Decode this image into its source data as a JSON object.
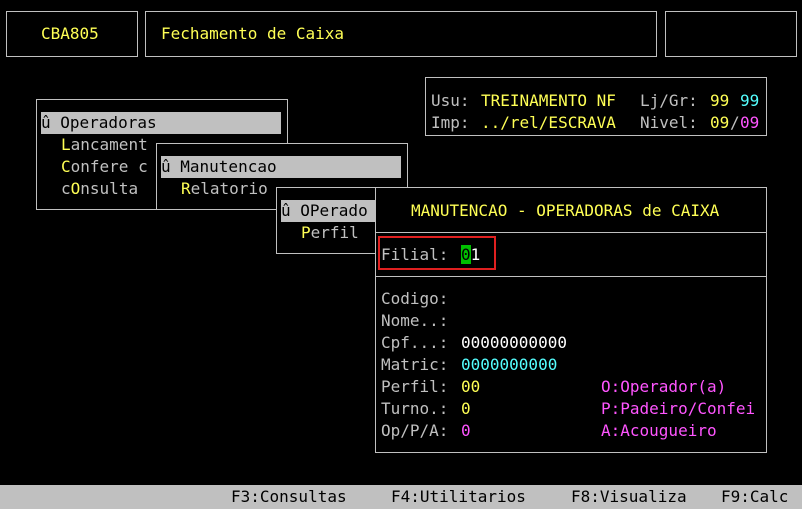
{
  "header": {
    "program_code": "CBA805",
    "screen_title": "Fechamento de Caixa"
  },
  "info": {
    "usu_label": "Usu:",
    "usu_value": "TREINAMENTO NF",
    "ljgr_label": "Lj/Gr:",
    "lj_value": "99",
    "gr_value": "99",
    "imp_label": "Imp:",
    "imp_value": "../rel/ESCRAVA",
    "nivel_label": "Nivel:",
    "nivel_a": "09",
    "nivel_sep": "/",
    "nivel_b": "09"
  },
  "menu1": {
    "selected": "û Operadoras",
    "items": [
      {
        "hot": "L",
        "rest": "ancament"
      },
      {
        "hot": "C",
        "rest": "onfere c"
      },
      {
        "pre": "c",
        "hot": "O",
        "rest": "nsulta"
      }
    ]
  },
  "menu2": {
    "selected": "û Manutencao",
    "items": [
      {
        "hot": "R",
        "rest": "elatorio"
      }
    ]
  },
  "menu3": {
    "selected": "û OPerado",
    "items": [
      {
        "hot": "P",
        "rest": "erfil"
      }
    ]
  },
  "form": {
    "title": "MANUTENCAO - OPERADORAS de CAIXA",
    "filial_label": "Filial:",
    "filial_cursor": "0",
    "filial_rest": "1",
    "codigo_label": "Codigo:",
    "nome_label": "Nome..:",
    "cpf_label": "Cpf...:",
    "cpf_value": "00000000000",
    "matric_label": "Matric:",
    "matric_value": "0000000000",
    "perfil_label": "Perfil:",
    "perfil_value": "00",
    "turno_label": "Turno.:",
    "turno_value": "0",
    "opa_label": "Op/P/A:",
    "opa_value": "0",
    "legend": [
      "O:Operador(a)",
      "P:Padeiro/Confei",
      "A:Acougueiro"
    ]
  },
  "statusbar": {
    "f3": "F3:Consultas",
    "f4": "F4:Utilitarios",
    "f8": "F8:Visualiza",
    "f9": "F9:Calc"
  },
  "colors": {
    "background": "#000000",
    "yellow": "#ffff55",
    "cyan": "#55ffff",
    "magenta": "#ff55ff",
    "highlight_box": "#e02020",
    "cursor": "#00c000"
  }
}
